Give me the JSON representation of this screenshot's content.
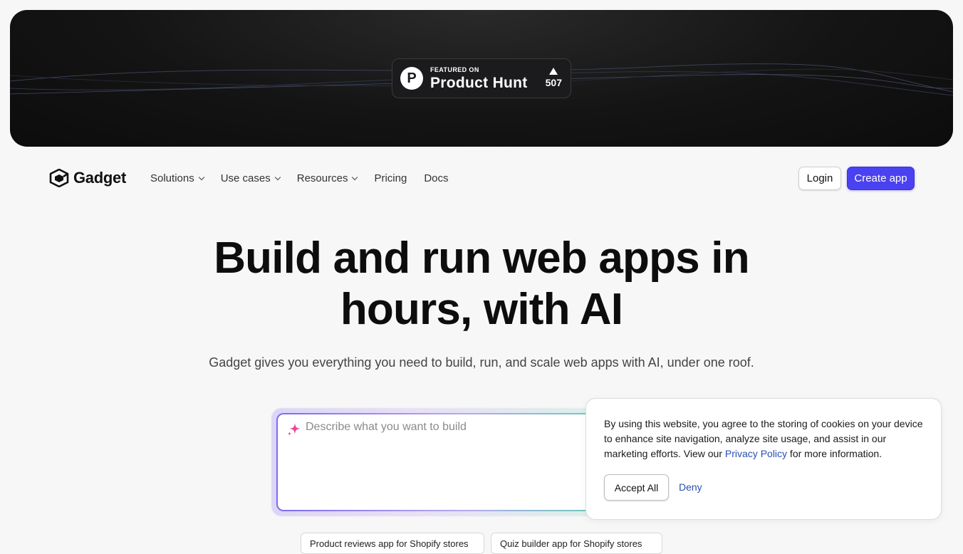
{
  "banner": {
    "badge": {
      "featured_label": "FEATURED ON",
      "product_label": "Product Hunt",
      "vote_count": "507"
    }
  },
  "nav": {
    "brand": "Gadget",
    "links": [
      {
        "label": "Solutions",
        "has_dropdown": true
      },
      {
        "label": "Use cases",
        "has_dropdown": true
      },
      {
        "label": "Resources",
        "has_dropdown": true
      },
      {
        "label": "Pricing",
        "has_dropdown": false
      },
      {
        "label": "Docs",
        "has_dropdown": false
      }
    ],
    "login_label": "Login",
    "create_label": "Create app",
    "accent_color": "#4a41f0"
  },
  "hero": {
    "title_line1": "Build and run web apps in",
    "title_line2": "hours, with AI",
    "subtitle": "Gadget gives you everything you need to build, run, and scale web apps with AI, under one roof."
  },
  "prompt": {
    "placeholder": "Describe what you want to build",
    "value": ""
  },
  "suggestions": [
    "Product reviews app for Shopify stores",
    "Quiz builder app for Shopify stores"
  ],
  "cookie": {
    "text_before": "By using this website, you agree to the storing of cookies on your device to enhance site navigation, analyze site usage, and assist in our marketing efforts. View our ",
    "link_text": "Privacy Policy",
    "text_after": " for more information.",
    "accept_label": "Accept All",
    "deny_label": "Deny"
  }
}
